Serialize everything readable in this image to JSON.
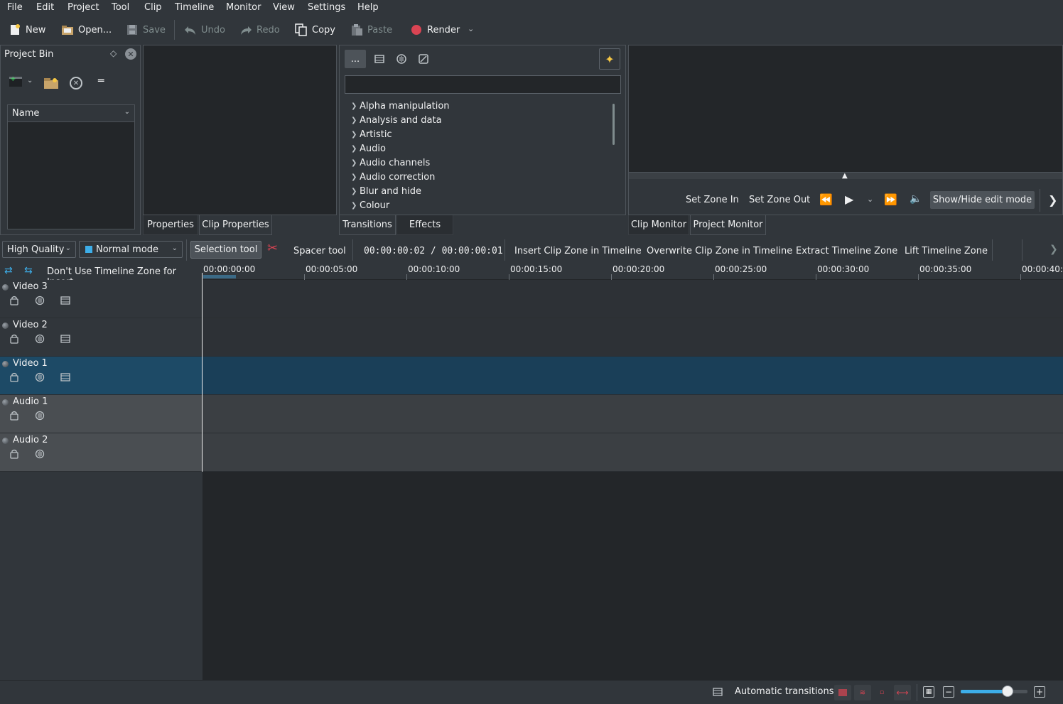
{
  "menubar": {
    "items": [
      "File",
      "Edit",
      "Project",
      "Tool",
      "Clip",
      "Timeline",
      "Monitor",
      "View",
      "Settings",
      "Help"
    ]
  },
  "toolbar": {
    "new_label": "New",
    "open_label": "Open...",
    "save_label": "Save",
    "undo_label": "Undo",
    "redo_label": "Redo",
    "copy_label": "Copy",
    "paste_label": "Paste",
    "render_label": "Render"
  },
  "project_bin": {
    "title": "Project Bin",
    "column_header": "Name"
  },
  "left_tabs": {
    "properties": "Properties",
    "clip_properties": "Clip Properties"
  },
  "effects_panel": {
    "more_label": "...",
    "search_value": "",
    "categories": [
      "Alpha manipulation",
      "Analysis and data",
      "Artistic",
      "Audio",
      "Audio channels",
      "Audio correction",
      "Blur and hide",
      "Colour"
    ],
    "tabs": {
      "transitions": "Transitions",
      "effects": "Effects"
    }
  },
  "monitor": {
    "set_zone_in": "Set Zone In",
    "set_zone_out": "Set Zone Out",
    "show_hide_edit": "Show/Hide edit mode",
    "tabs": {
      "clip_monitor": "Clip Monitor",
      "project_monitor": "Project Monitor"
    }
  },
  "timeline_toolbar": {
    "quality": "High Quality",
    "mode": "Normal mode",
    "selection_tool": "Selection tool",
    "spacer_tool": "Spacer tool",
    "timecode": "00:00:00:02 / 00:00:00:01",
    "insert_zone": "Insert Clip Zone in Timeline",
    "overwrite_zone": "Overwrite Clip Zone in Timeline",
    "extract_zone": "Extract Timeline Zone",
    "lift_zone": "Lift Timeline Zone"
  },
  "timeline": {
    "zone_label": "Don't Use Timeline Zone for Insert",
    "ruler": [
      "00:00:00:00",
      "00:00:05:00",
      "00:00:10:00",
      "00:00:15:00",
      "00:00:20:00",
      "00:00:25:00",
      "00:00:30:00",
      "00:00:35:00",
      "00:00:40:"
    ],
    "tracks": [
      {
        "name": "Video 3",
        "kind": "video"
      },
      {
        "name": "Video 2",
        "kind": "video"
      },
      {
        "name": "Video 1",
        "kind": "video"
      },
      {
        "name": "Audio 1",
        "kind": "audio"
      },
      {
        "name": "Audio 2",
        "kind": "audio"
      }
    ]
  },
  "status_bar": {
    "automatic_transitions": "Automatic transitions",
    "zoom_level_fraction": 0.7
  },
  "colors": {
    "accent": "#3daee9",
    "selected_track": "#1d4a66",
    "render_red": "#da4453",
    "star_yellow": "#f6c744"
  }
}
